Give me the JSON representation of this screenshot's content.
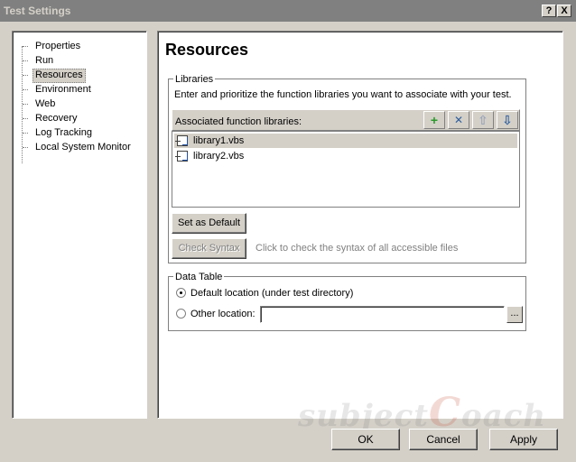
{
  "window": {
    "title": "Test Settings",
    "help_label": "?",
    "close_label": "X"
  },
  "tree": {
    "items": [
      {
        "label": "Properties"
      },
      {
        "label": "Run"
      },
      {
        "label": "Resources"
      },
      {
        "label": "Environment"
      },
      {
        "label": "Web"
      },
      {
        "label": "Recovery"
      },
      {
        "label": "Log Tracking"
      },
      {
        "label": "Local System Monitor"
      }
    ],
    "selected": "Resources"
  },
  "page": {
    "title": "Resources"
  },
  "libraries": {
    "group_label": "Libraries",
    "description": "Enter and prioritize the function libraries you want to associate with your test.",
    "list_label": "Associated function libraries:",
    "icons": {
      "add": "plus-icon",
      "remove": "x-icon",
      "up": "arrow-up-icon",
      "down": "arrow-down-icon"
    },
    "add_glyph": "+",
    "remove_glyph": "✕",
    "up_glyph": "⇧",
    "down_glyph": "⇩",
    "items": [
      {
        "name": "library1.vbs"
      },
      {
        "name": "library2.vbs"
      }
    ],
    "set_default_label": "Set as Default",
    "check_syntax_label": "Check Syntax",
    "check_syntax_hint": "Click to check the syntax of all accessible files"
  },
  "data_table": {
    "group_label": "Data Table",
    "default_option": "Default location (under test directory)",
    "other_option": "Other location:",
    "other_value": "",
    "browse_label": "..."
  },
  "footer": {
    "ok_label": "OK",
    "cancel_label": "Cancel",
    "apply_label": "Apply"
  },
  "watermark": {
    "text_a": "subject",
    "text_c": "C",
    "text_b": "oach"
  }
}
